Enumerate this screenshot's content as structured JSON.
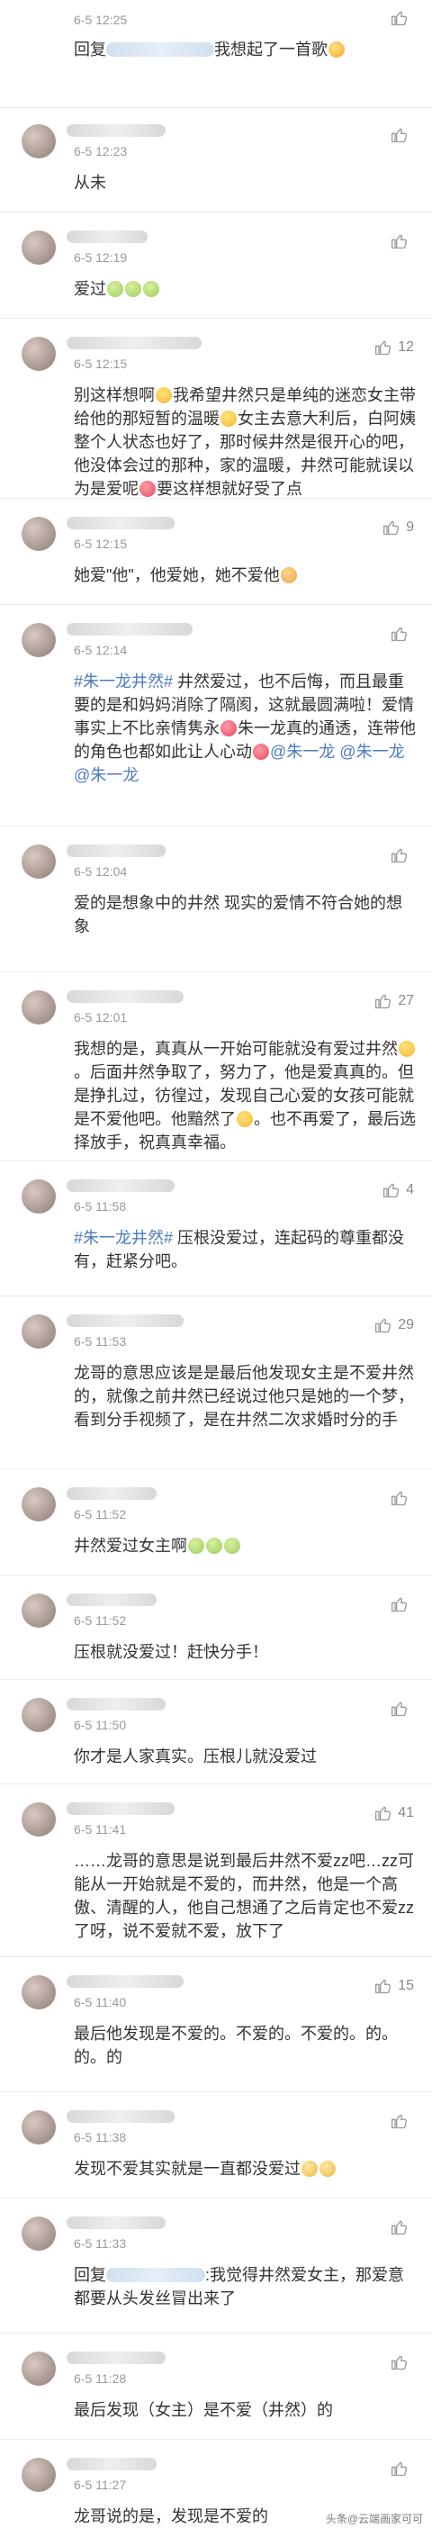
{
  "comments": [
    {
      "ts": "6-5 12:25",
      "likes": "",
      "parts": [
        {
          "t": "回复"
        },
        {
          "redact": 120
        },
        {
          "t": "我想起了一首歌"
        },
        {
          "emoji": "laugh"
        }
      ]
    },
    {
      "ts": "6-5 12:23",
      "likes": "",
      "parts": [
        {
          "t": "从未"
        }
      ]
    },
    {
      "ts": "6-5 12:19",
      "likes": "",
      "parts": [
        {
          "t": "爱过"
        },
        {
          "emoji": "sad"
        },
        {
          "emoji": "sad"
        },
        {
          "emoji": "sad"
        }
      ]
    },
    {
      "ts": "6-5 12:15",
      "likes": "12",
      "parts": [
        {
          "t": "别这样想啊"
        },
        {
          "emoji": "smile"
        },
        {
          "t": "我希望井然只是单纯的迷恋女主带给他的那短暂的温暖"
        },
        {
          "emoji": "smile"
        },
        {
          "t": "女主去意大利后，白阿姨整个人状态也好了，那时候井然是很开心的吧，他没体会过的那种，家的温暖，井然可能就误以为是爱呢"
        },
        {
          "emoji": "heart"
        },
        {
          "t": "要这样想就好受了点"
        }
      ]
    },
    {
      "ts": "6-5 12:15",
      "likes": "9",
      "parts": [
        {
          "t": "她爱\"他\"，他爱她，她不爱他"
        },
        {
          "emoji": "bowl"
        }
      ]
    },
    {
      "ts": "6-5 12:14",
      "likes": "",
      "parts": [
        {
          "topic": "#朱一龙井然#"
        },
        {
          "t": " 井然爱过，也不后悔，而且最重要的是和妈妈消除了隔阂，这就最圆满啦！爱情事实上不比亲情隽永"
        },
        {
          "emoji": "heart"
        },
        {
          "t": "朱一龙真的通透，连带他的角色也都如此让人心动"
        },
        {
          "emoji": "heart"
        },
        {
          "mention": "@朱一龙"
        },
        {
          "t": " "
        },
        {
          "mention": "@朱一龙"
        },
        {
          "t": " "
        },
        {
          "mention": "@朱一龙"
        }
      ]
    },
    {
      "ts": "6-5 12:04",
      "likes": "",
      "parts": [
        {
          "t": "爱的是想象中的井然 现实的爱情不符合她的想象"
        }
      ]
    },
    {
      "ts": "6-5 12:01",
      "likes": "27",
      "parts": [
        {
          "t": "我想的是，真真从一开始可能就没有爱过井然"
        },
        {
          "emoji": "smile"
        },
        {
          "t": "。后面井然争取了，努力了，他是爱真真的。但是挣扎过，彷徨过，发现自己心爱的女孩可能就是不爱他吧。他黯然了"
        },
        {
          "emoji": "smile"
        },
        {
          "t": "。也不再爱了，最后选择放手，祝真真幸福。"
        }
      ]
    },
    {
      "ts": "6-5 11:58",
      "likes": "4",
      "parts": [
        {
          "topic": "#朱一龙井然#"
        },
        {
          "t": " 压根没爱过，连起码的尊重都没有，赶紧分吧。"
        }
      ]
    },
    {
      "ts": "6-5 11:53",
      "likes": "29",
      "parts": [
        {
          "t": "龙哥的意思应该是是最后他发现女主是不爱井然的，就像之前井然已经说过他只是她的一个梦，看到分手视频了，是在井然二次求婚时分的手"
        }
      ]
    },
    {
      "ts": "6-5 11:52",
      "likes": "",
      "parts": [
        {
          "t": "井然爱过女主啊"
        },
        {
          "emoji": "sad"
        },
        {
          "emoji": "sad"
        },
        {
          "emoji": "sad"
        }
      ]
    },
    {
      "ts": "6-5 11:52",
      "likes": "",
      "parts": [
        {
          "t": "压根就没爱过！赶快分手！"
        }
      ]
    },
    {
      "ts": "6-5 11:50",
      "likes": "",
      "parts": [
        {
          "t": "你才是人家真实。压根儿就没爱过"
        }
      ]
    },
    {
      "ts": "6-5 11:41",
      "likes": "41",
      "parts": [
        {
          "t": "……龙哥的意思是说到最后井然不爱zz吧…zz可能从一开始就是不爱的，而井然，他是一个高傲、清醒的人，他自己想通了之后肯定也不爱zz了呀，说不爱就不爱，放下了"
        }
      ]
    },
    {
      "ts": "6-5 11:40",
      "likes": "15",
      "parts": [
        {
          "t": "最后他发现是不爱的。不爱的。不爱的。的。的。的"
        }
      ]
    },
    {
      "ts": "6-5 11:38",
      "likes": "",
      "parts": [
        {
          "t": "发现不爱其实就是一直都没爱过"
        },
        {
          "emoji": "cry"
        },
        {
          "emoji": "cry"
        }
      ]
    },
    {
      "ts": "6-5 11:33",
      "likes": "",
      "parts": [
        {
          "t": "回复"
        },
        {
          "redact": 110
        },
        {
          "t": ":我觉得井然爱女主，那爱意都要从头发丝冒出来了"
        }
      ]
    },
    {
      "ts": "6-5 11:28",
      "likes": "",
      "parts": [
        {
          "t": "最后发现（女主）是不爱（井然）的"
        }
      ]
    },
    {
      "ts": "6-5 11:27",
      "likes": "",
      "parts": [
        {
          "t": "龙哥说的是，发现是不爱的"
        }
      ]
    }
  ],
  "watermark": "头条@云端画家可可"
}
